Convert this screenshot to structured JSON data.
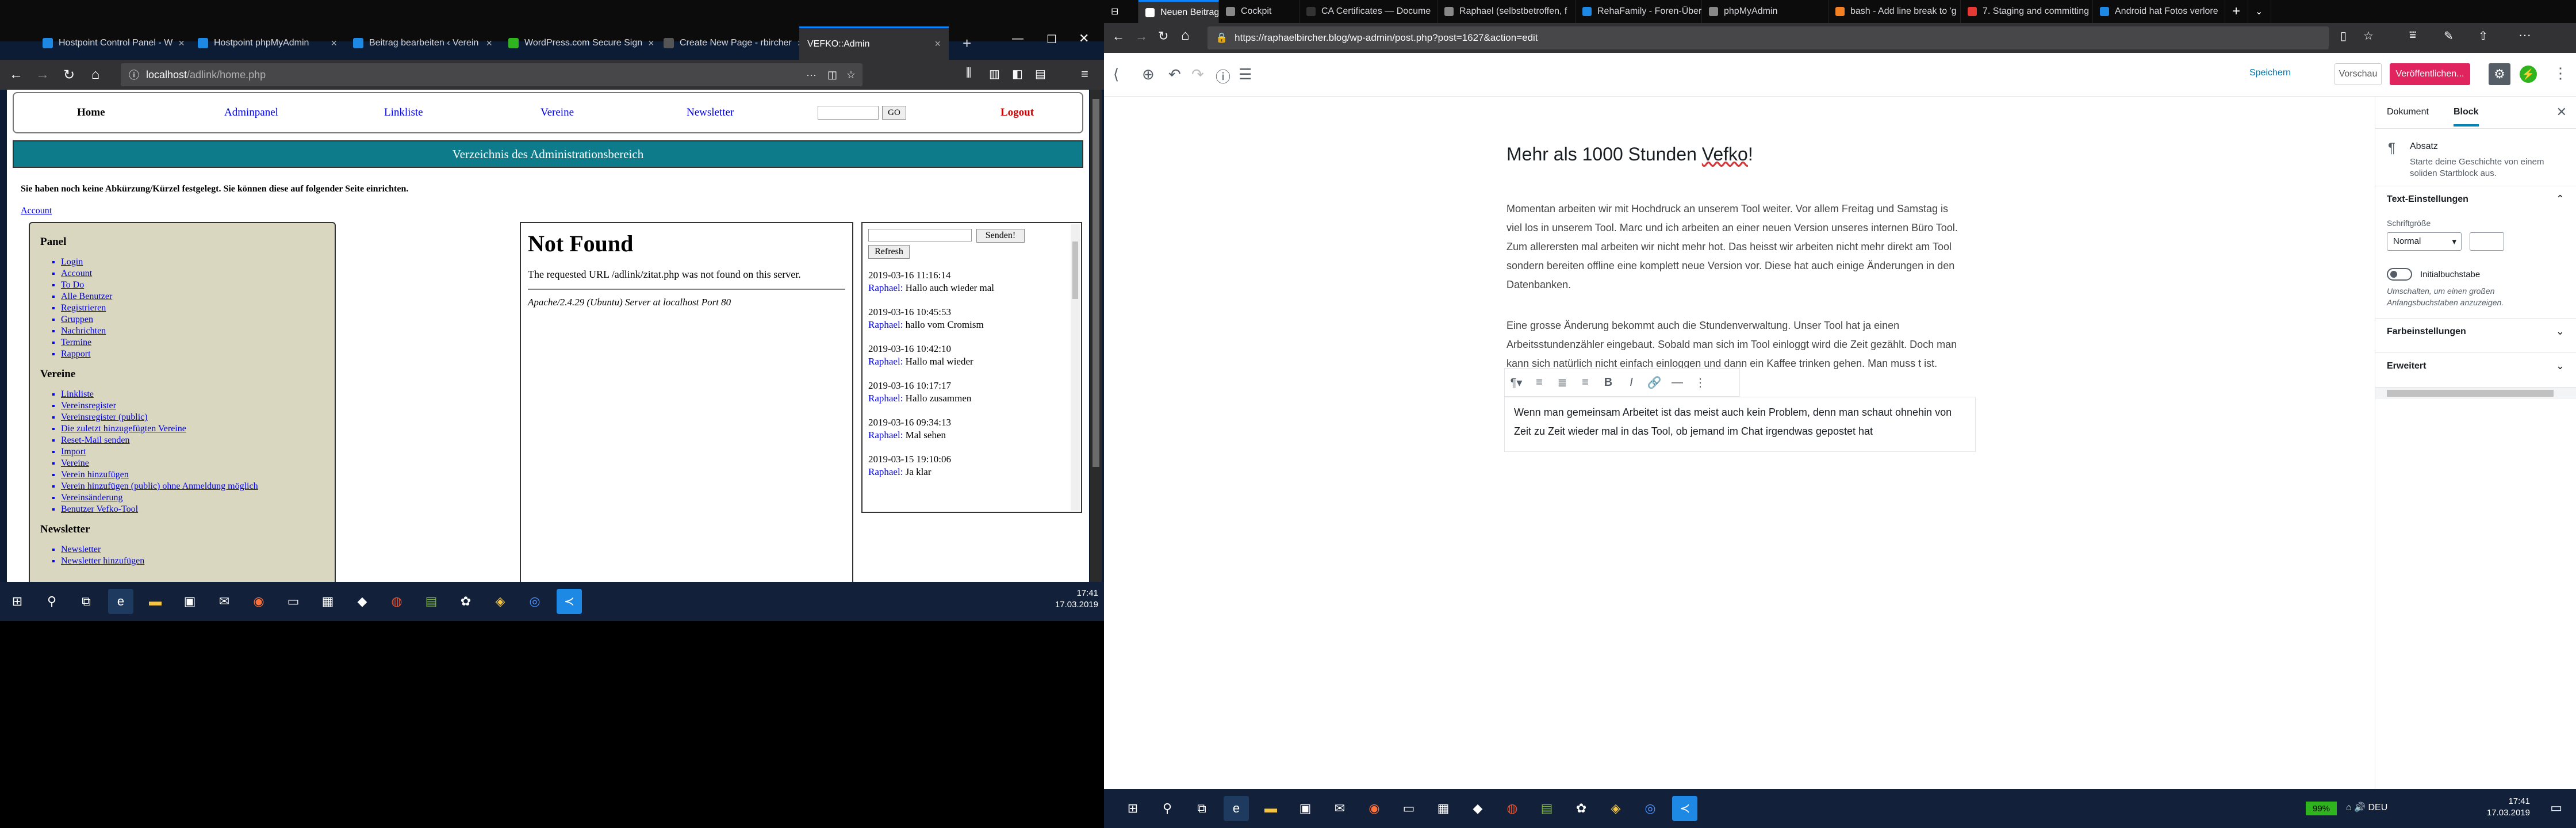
{
  "left": {
    "tabs": [
      {
        "label": "Hostpoint Control Panel - W",
        "color": "#1e88e5"
      },
      {
        "label": "Hostpoint phpMyAdmin",
        "color": "#1e88e5"
      },
      {
        "label": "Beitrag bearbeiten ‹ Verein",
        "color": "#1e88e5"
      },
      {
        "label": "WordPress.com Secure Sign",
        "color": "#2fb41f"
      },
      {
        "label": "Create New Page - rbircher",
        "color": "#555555"
      },
      {
        "label": "VEFKO::Admin",
        "color": "#555555"
      }
    ],
    "url_host": "localhost",
    "url_path": "/adlink/home.php",
    "nav": {
      "home": "Home",
      "admin": "Adminpanel",
      "link": "Linkliste",
      "verein": "Vereine",
      "news": "Newsletter",
      "go": "GO",
      "logout": "Logout"
    },
    "banner": "Verzeichnis des Administrationsbereich",
    "notice": "Sie haben noch keine Abkürzung/Kürzel festgelegt. Sie können diese auf folgender Seite einrichten.",
    "account_link": "Account",
    "panel": {
      "title1": "Panel",
      "items1": [
        "Login",
        "Account",
        "To Do",
        "Alle Benutzer",
        "Registrieren",
        "Gruppen",
        "Nachrichten",
        "Termine",
        "Rapport"
      ],
      "title2": "Vereine",
      "items2": [
        "Linkliste",
        "Vereinsregister",
        "Vereinsregister (public)",
        "Die zuletzt hinzugefügten Vereine",
        "Reset-Mail senden",
        "Import",
        "Vereine",
        "Verein hinzufügen",
        "Verein hinzufügen (public) ohne Anmeldung möglich",
        "Vereinsänderung",
        "Benutzer Vefko-Tool"
      ],
      "title3": "Newsletter",
      "items3": [
        "Newsletter",
        "Newsletter hinzufügen"
      ]
    },
    "notfound": {
      "title": "Not Found",
      "text": "The requested URL /adlink/zitat.php was not found on this server.",
      "server": "Apache/2.4.29 (Ubuntu) Server at localhost Port 80"
    },
    "chat": {
      "send": "Senden!",
      "refresh": "Refresh",
      "messages": [
        {
          "time": "2019-03-16 11:16:14",
          "user": "Raphael:",
          "text": " Hallo auch wieder mal"
        },
        {
          "time": "2019-03-16 10:45:53",
          "user": "Raphael:",
          "text": " hallo vom Cromism"
        },
        {
          "time": "2019-03-16 10:42:10",
          "user": "Raphael:",
          "text": " Hallo mal wieder"
        },
        {
          "time": "2019-03-16 10:17:17",
          "user": "Raphael:",
          "text": " Hallo zusammen"
        },
        {
          "time": "2019-03-16 09:34:13",
          "user": "Raphael:",
          "text": " Mal sehen"
        },
        {
          "time": "2019-03-15 19:10:06",
          "user": "Raphael:",
          "text": " Ja klar"
        }
      ]
    },
    "clock_time": "17:41",
    "clock_date": "17.03.2019"
  },
  "right": {
    "tabs": [
      {
        "label": "Neuen Beitrag erstelle",
        "color": "#ffffff"
      },
      {
        "label": "Cockpit",
        "color": "#888888"
      },
      {
        "label": "CA Certificates — Docume",
        "color": "#333333"
      },
      {
        "label": "Raphael (selbstbetroffen, f",
        "color": "#888888"
      },
      {
        "label": "RehaFamily - Foren-Überu",
        "color": "#1e88e5"
      },
      {
        "label": "phpMyAdmin",
        "color": "#888888"
      },
      {
        "label": "bash - Add line break to 'g",
        "color": "#f48024"
      },
      {
        "label": "7. Staging and committing",
        "color": "#e53935"
      },
      {
        "label": "Android hat Fotos verlore",
        "color": "#1e88e5"
      }
    ],
    "url": "https://raphaelbircher.blog/wp-admin/post.php?post=1627&action=edit",
    "save": "Speichern",
    "preview": "Vorschau",
    "publish": "Veröffentlichen...",
    "post_title_a": "Mehr als 1000 Stunden ",
    "post_title_b": "Vefko",
    "post_title_c": "!",
    "para1": "Momentan arbeiten wir mit Hochdruck an unserem Tool weiter. Vor allem Freitag und Samstag is viel los in unserem Tool. Marc und ich arbeiten an einer neuen Version unseres internen Büro Tool. Zum allerersten mal arbeiten wir nicht mehr hot. Das heisst wir arbeiten nicht mehr direkt am Tool sondern bereiten offline eine komplett neue Version vor. Diese hat auch einige Änderungen in den Datenbanken.",
    "para2": "Eine grosse Änderung bekommt auch die Stundenverwaltung. Unser Tool hat ja einen Arbeitsstundenzähler eingebaut. Sobald man sich im Tool einloggt wird die Zeit gezählt. Doch man kann sich natürlich nicht einfach einloggen und dann ein Kaffee trinken gehen. Man muss",
    "para2_tail": "t ist.",
    "para3": "Wenn man gemeinsam Arbeitet ist das meist auch kein Problem, denn man schaut ohnehin von Zeit zu Zeit wieder mal in das Tool, ob jemand im Chat irgendwas gepostet hat",
    "sidebar": {
      "tab_doc": "Dokument",
      "tab_block": "Block",
      "block_name": "Absatz",
      "block_desc": "Starte deine Geschichte von einem soliden Startblock aus.",
      "text_settings": "Text-Einstellungen",
      "font_size_label": "Schriftgröße",
      "font_size_value": "Normal",
      "dropcap_label": "Initialbuchstabe",
      "dropcap_help": "Umschalten, um einen großen Anfangsbuchstaben anzuzeigen.",
      "color_settings": "Farbeinstellungen",
      "advanced": "Erweitert"
    },
    "battery": "99%",
    "lang": "DEU",
    "clock_time": "17:41",
    "clock_date": "17.03.2019"
  }
}
